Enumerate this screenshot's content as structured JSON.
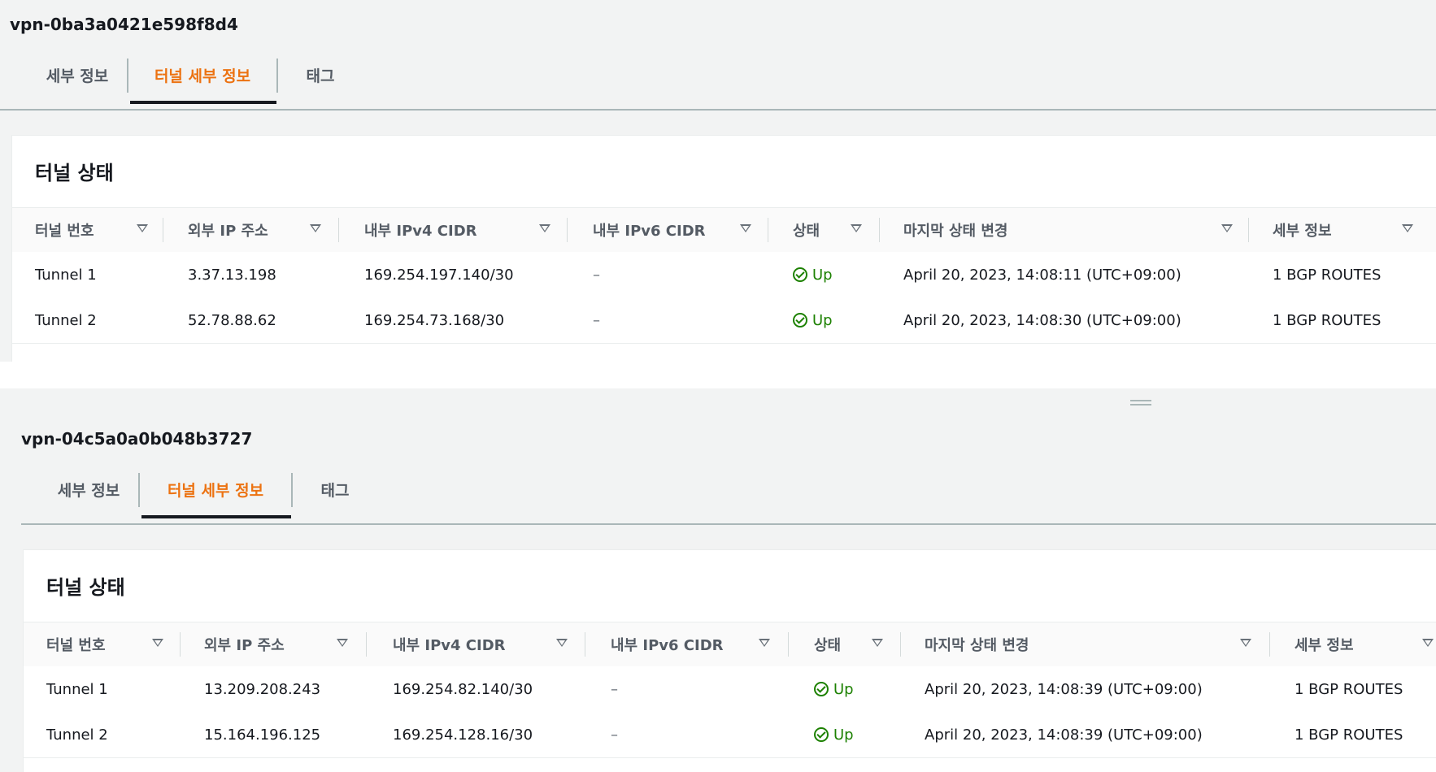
{
  "common": {
    "tabs": [
      "세부 정보",
      "터널 세부 정보",
      "태그"
    ],
    "card_title": "터널 상태",
    "columns": [
      "터널 번호",
      "외부 IP 주소",
      "내부 IPv4 CIDR",
      "내부 IPv6 CIDR",
      "상태",
      "마지막 상태 변경",
      "세부 정보"
    ]
  },
  "vpn1": {
    "id": "vpn-0ba3a0421e598f8d4",
    "rows": [
      {
        "tunnel": "Tunnel 1",
        "outside_ip": "3.37.13.198",
        "inside_ipv4": "169.254.197.140/30",
        "inside_ipv6": "–",
        "status": "Up",
        "last_change": "April 20, 2023, 14:08:11 (UTC+09:00)",
        "details": "1 BGP ROUTES"
      },
      {
        "tunnel": "Tunnel 2",
        "outside_ip": "52.78.88.62",
        "inside_ipv4": "169.254.73.168/30",
        "inside_ipv6": "–",
        "status": "Up",
        "last_change": "April 20, 2023, 14:08:30 (UTC+09:00)",
        "details": "1 BGP ROUTES"
      }
    ]
  },
  "vpn2": {
    "id": "vpn-04c5a0a0b048b3727",
    "rows": [
      {
        "tunnel": "Tunnel 1",
        "outside_ip": "13.209.208.243",
        "inside_ipv4": "169.254.82.140/30",
        "inside_ipv6": "–",
        "status": "Up",
        "last_change": "April 20, 2023, 14:08:39 (UTC+09:00)",
        "details": "1 BGP ROUTES"
      },
      {
        "tunnel": "Tunnel 2",
        "outside_ip": "15.164.196.125",
        "inside_ipv4": "169.254.128.16/30",
        "inside_ipv6": "–",
        "status": "Up",
        "last_change": "April 20, 2023, 14:08:39 (UTC+09:00)",
        "details": "1 BGP ROUTES"
      }
    ]
  },
  "colors": {
    "accent": "#ec7211",
    "status_ok": "#1d8102"
  },
  "icons": {
    "sort": "caret-down-icon",
    "status": "check-circle-icon",
    "grip": "resize-grip-icon"
  }
}
